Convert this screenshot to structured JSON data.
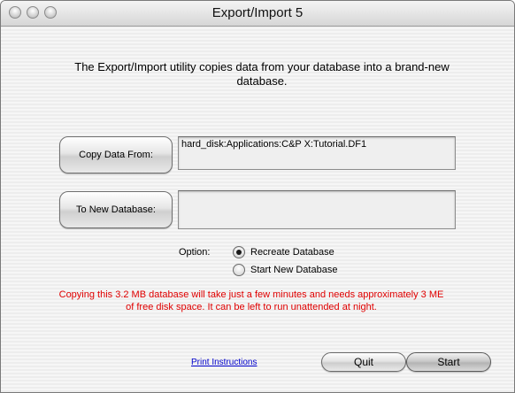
{
  "window": {
    "title": "Export/Import 5"
  },
  "intro": {
    "line1": "The Export/Import utility copies data from your  database into a brand-new",
    "line2": "database."
  },
  "copy_from": {
    "button_label": "Copy Data From:",
    "path": "hard_disk:Applications:C&P X:Tutorial.DF1"
  },
  "to_new": {
    "button_label": "To New Database:",
    "path": ""
  },
  "options": {
    "label": "Option:",
    "items": [
      {
        "label": "Recreate Database",
        "checked": true
      },
      {
        "label": "Start New Database",
        "checked": false
      }
    ]
  },
  "warning": {
    "line1": "Copying this 3.2 MB database will take just a few minutes and needs approximately 3 ME",
    "line2": "of free disk space.  It can be left to run unattended at night.",
    "color": "#e00000"
  },
  "footer": {
    "print_link": "Print Instructions",
    "quit_label": "Quit",
    "start_label": "Start"
  },
  "colors": {
    "link": "#0000cc"
  }
}
